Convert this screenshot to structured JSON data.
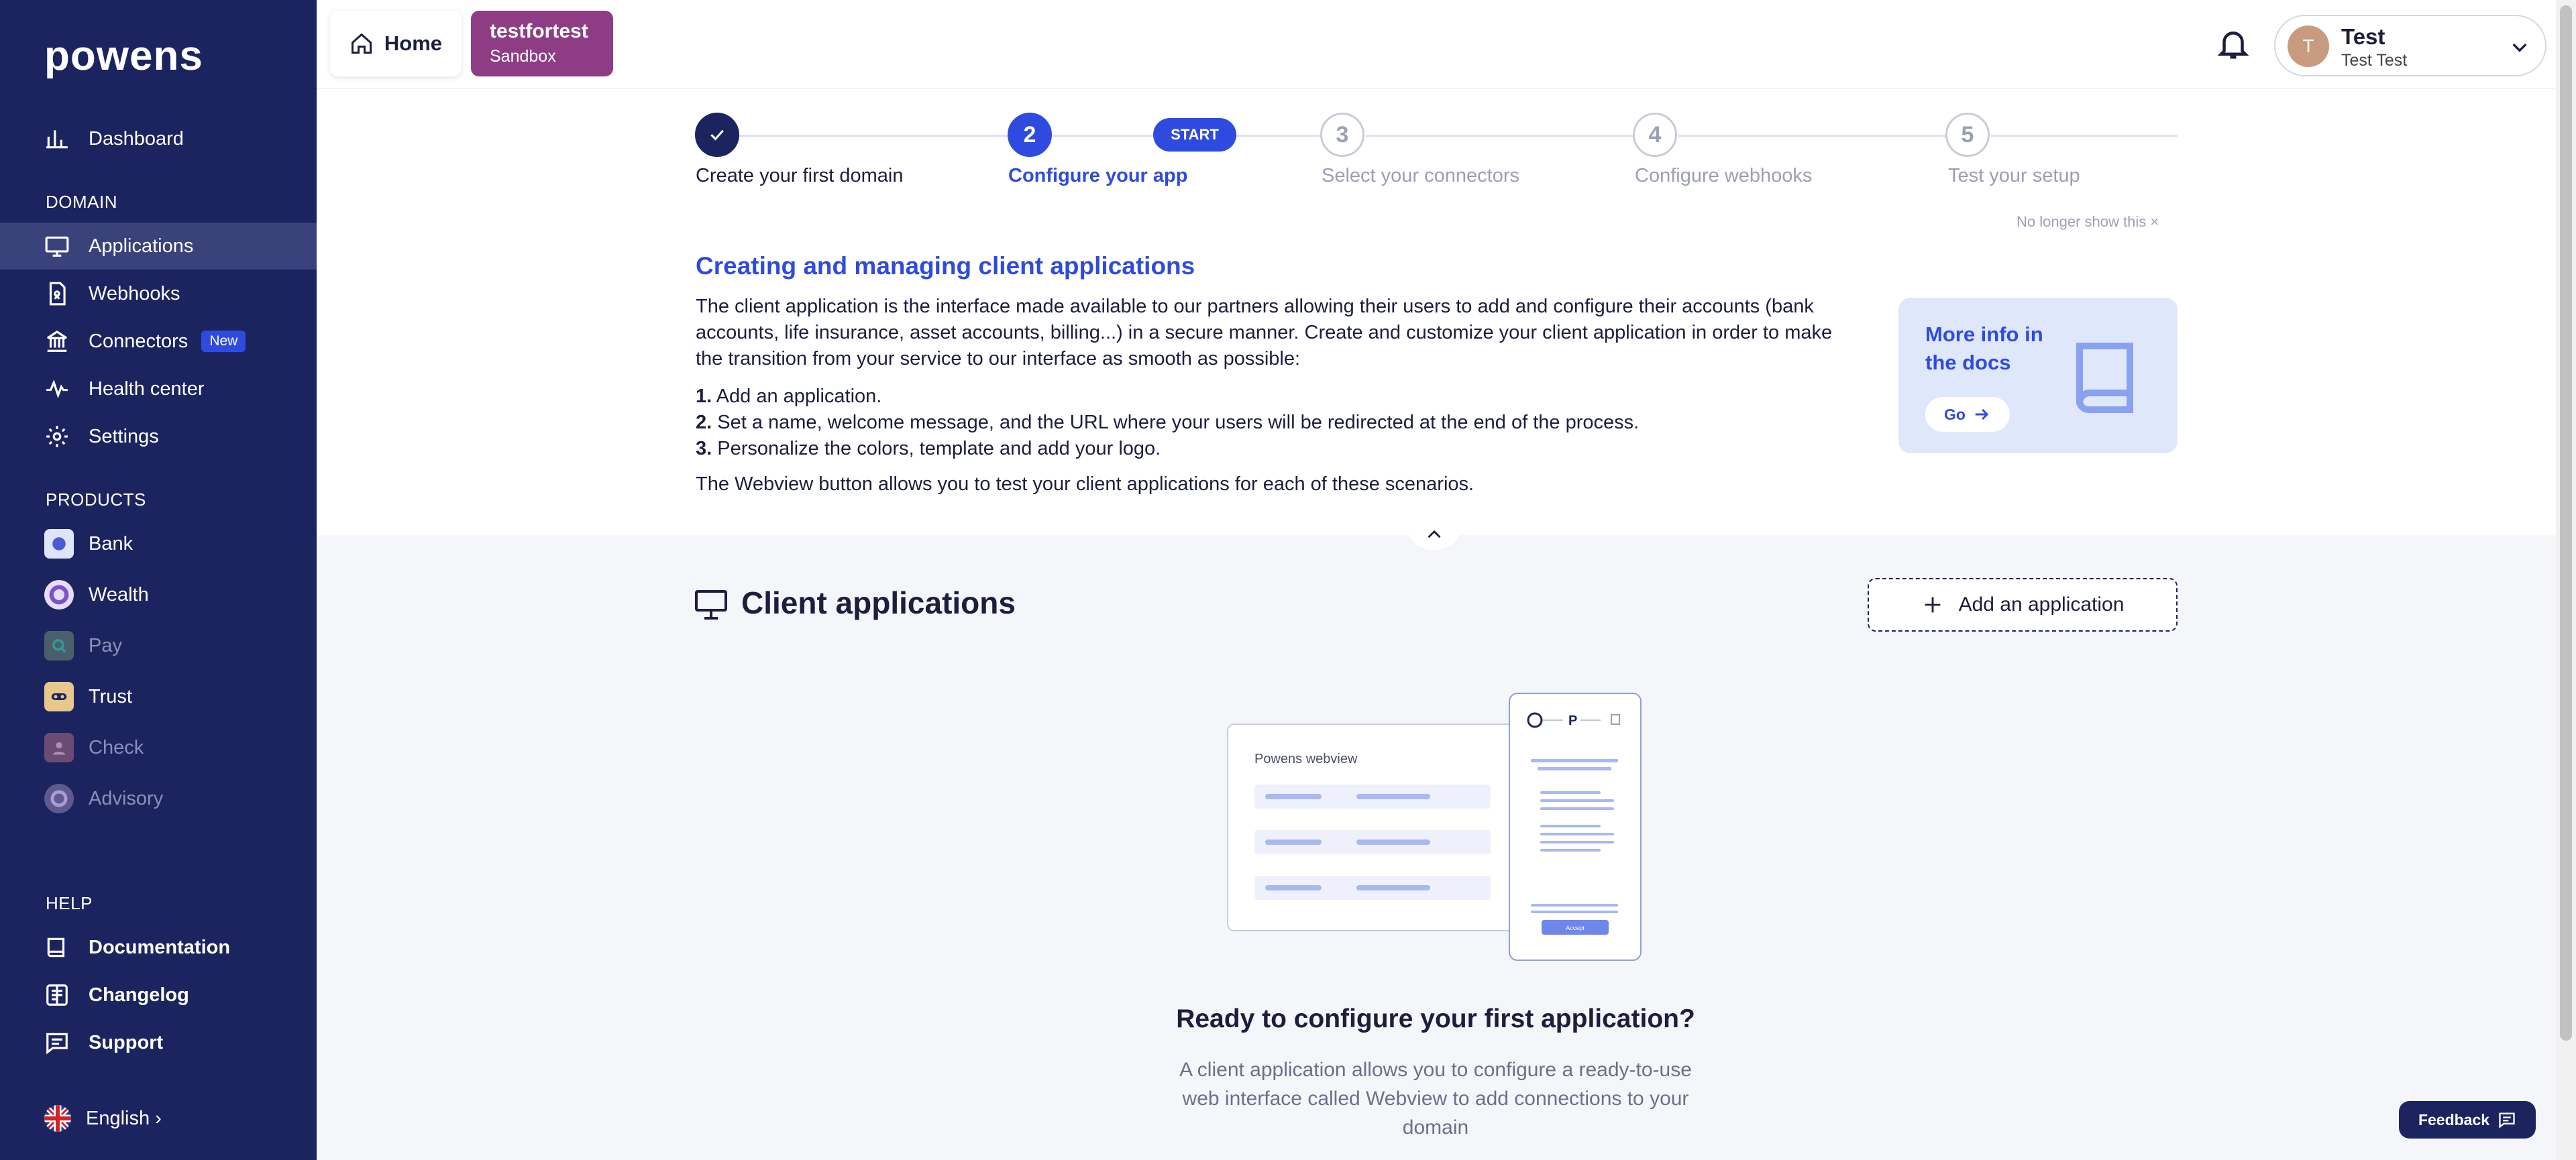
{
  "brand": {
    "logo": "powens"
  },
  "sidebar": {
    "items": [
      {
        "label": "Dashboard",
        "icon": "bar-chart-icon"
      },
      {
        "label": "Applications",
        "icon": "monitor-icon",
        "active": true
      },
      {
        "label": "Webhooks",
        "icon": "webhook-icon"
      },
      {
        "label": "Connectors",
        "icon": "bank-icon",
        "badge": "New"
      },
      {
        "label": "Health center",
        "icon": "pulse-icon"
      },
      {
        "label": "Settings",
        "icon": "gear-icon"
      }
    ],
    "section_domain": "DOMAIN",
    "section_products": "PRODUCTS",
    "products": [
      {
        "label": "Bank",
        "enabled": true,
        "color": "#4b5bd6"
      },
      {
        "label": "Wealth",
        "enabled": true,
        "color": "#7b52c9"
      },
      {
        "label": "Pay",
        "enabled": false,
        "color": "#2e9b94"
      },
      {
        "label": "Trust",
        "enabled": true,
        "color": "#e7c78c"
      },
      {
        "label": "Check",
        "enabled": false,
        "color": "#8e3d85"
      },
      {
        "label": "Advisory",
        "enabled": false,
        "color": "#7b52c9"
      }
    ],
    "section_help": "HELP",
    "help": [
      {
        "label": "Documentation",
        "icon": "book-icon"
      },
      {
        "label": "Changelog",
        "icon": "changelog-icon"
      },
      {
        "label": "Support",
        "icon": "chat-icon"
      }
    ],
    "language": "English"
  },
  "topbar": {
    "home_label": "Home",
    "env_name": "testfortest",
    "env_type": "Sandbox",
    "user_initial": "T",
    "user_name": "Test",
    "user_full": "Test Test"
  },
  "onboarding": {
    "steps": [
      {
        "num": "",
        "label": "Create your first domain",
        "state": "done"
      },
      {
        "num": "2",
        "label": "Configure your app",
        "state": "current"
      },
      {
        "num": "3",
        "label": "Select your connectors",
        "state": "todo"
      },
      {
        "num": "4",
        "label": "Configure webhooks",
        "state": "todo"
      },
      {
        "num": "5",
        "label": "Test your setup",
        "state": "todo"
      }
    ],
    "start_label": "START",
    "no_longer_show": "No longer show this ×",
    "title": "Creating and managing client applications",
    "paragraph": "The client application is the interface made available to our partners allowing their users to add and configure their accounts (bank accounts, life insurance, asset accounts, billing...) in a secure manner. Create and customize your client application in order to make the transition from your service to our interface as smooth as possible:",
    "list": [
      {
        "n": "1.",
        "text": "Add an application."
      },
      {
        "n": "2.",
        "text": "Set a name, welcome message, and the URL where your users will be redirected at the end of the process."
      },
      {
        "n": "3.",
        "text": "Personalize the colors, template and add your logo."
      }
    ],
    "footer": "The Webview button allows you to test your client applications for each of these scenarios.",
    "docs_title": "More info in the docs",
    "docs_go": "Go"
  },
  "client_apps": {
    "title": "Client applications",
    "add_label": "Add an application",
    "illustration_title": "Powens webview",
    "illustration_button": "Accept",
    "empty_title": "Ready to configure your first application?",
    "empty_desc": "A client application allows you to configure a ready-to-use web interface called Webview to add connections to your domain"
  },
  "feedback_label": "Feedback",
  "colors": {
    "sidebar": "#1c2460",
    "accent": "#2f4bdf",
    "env": "#8e3d85"
  }
}
